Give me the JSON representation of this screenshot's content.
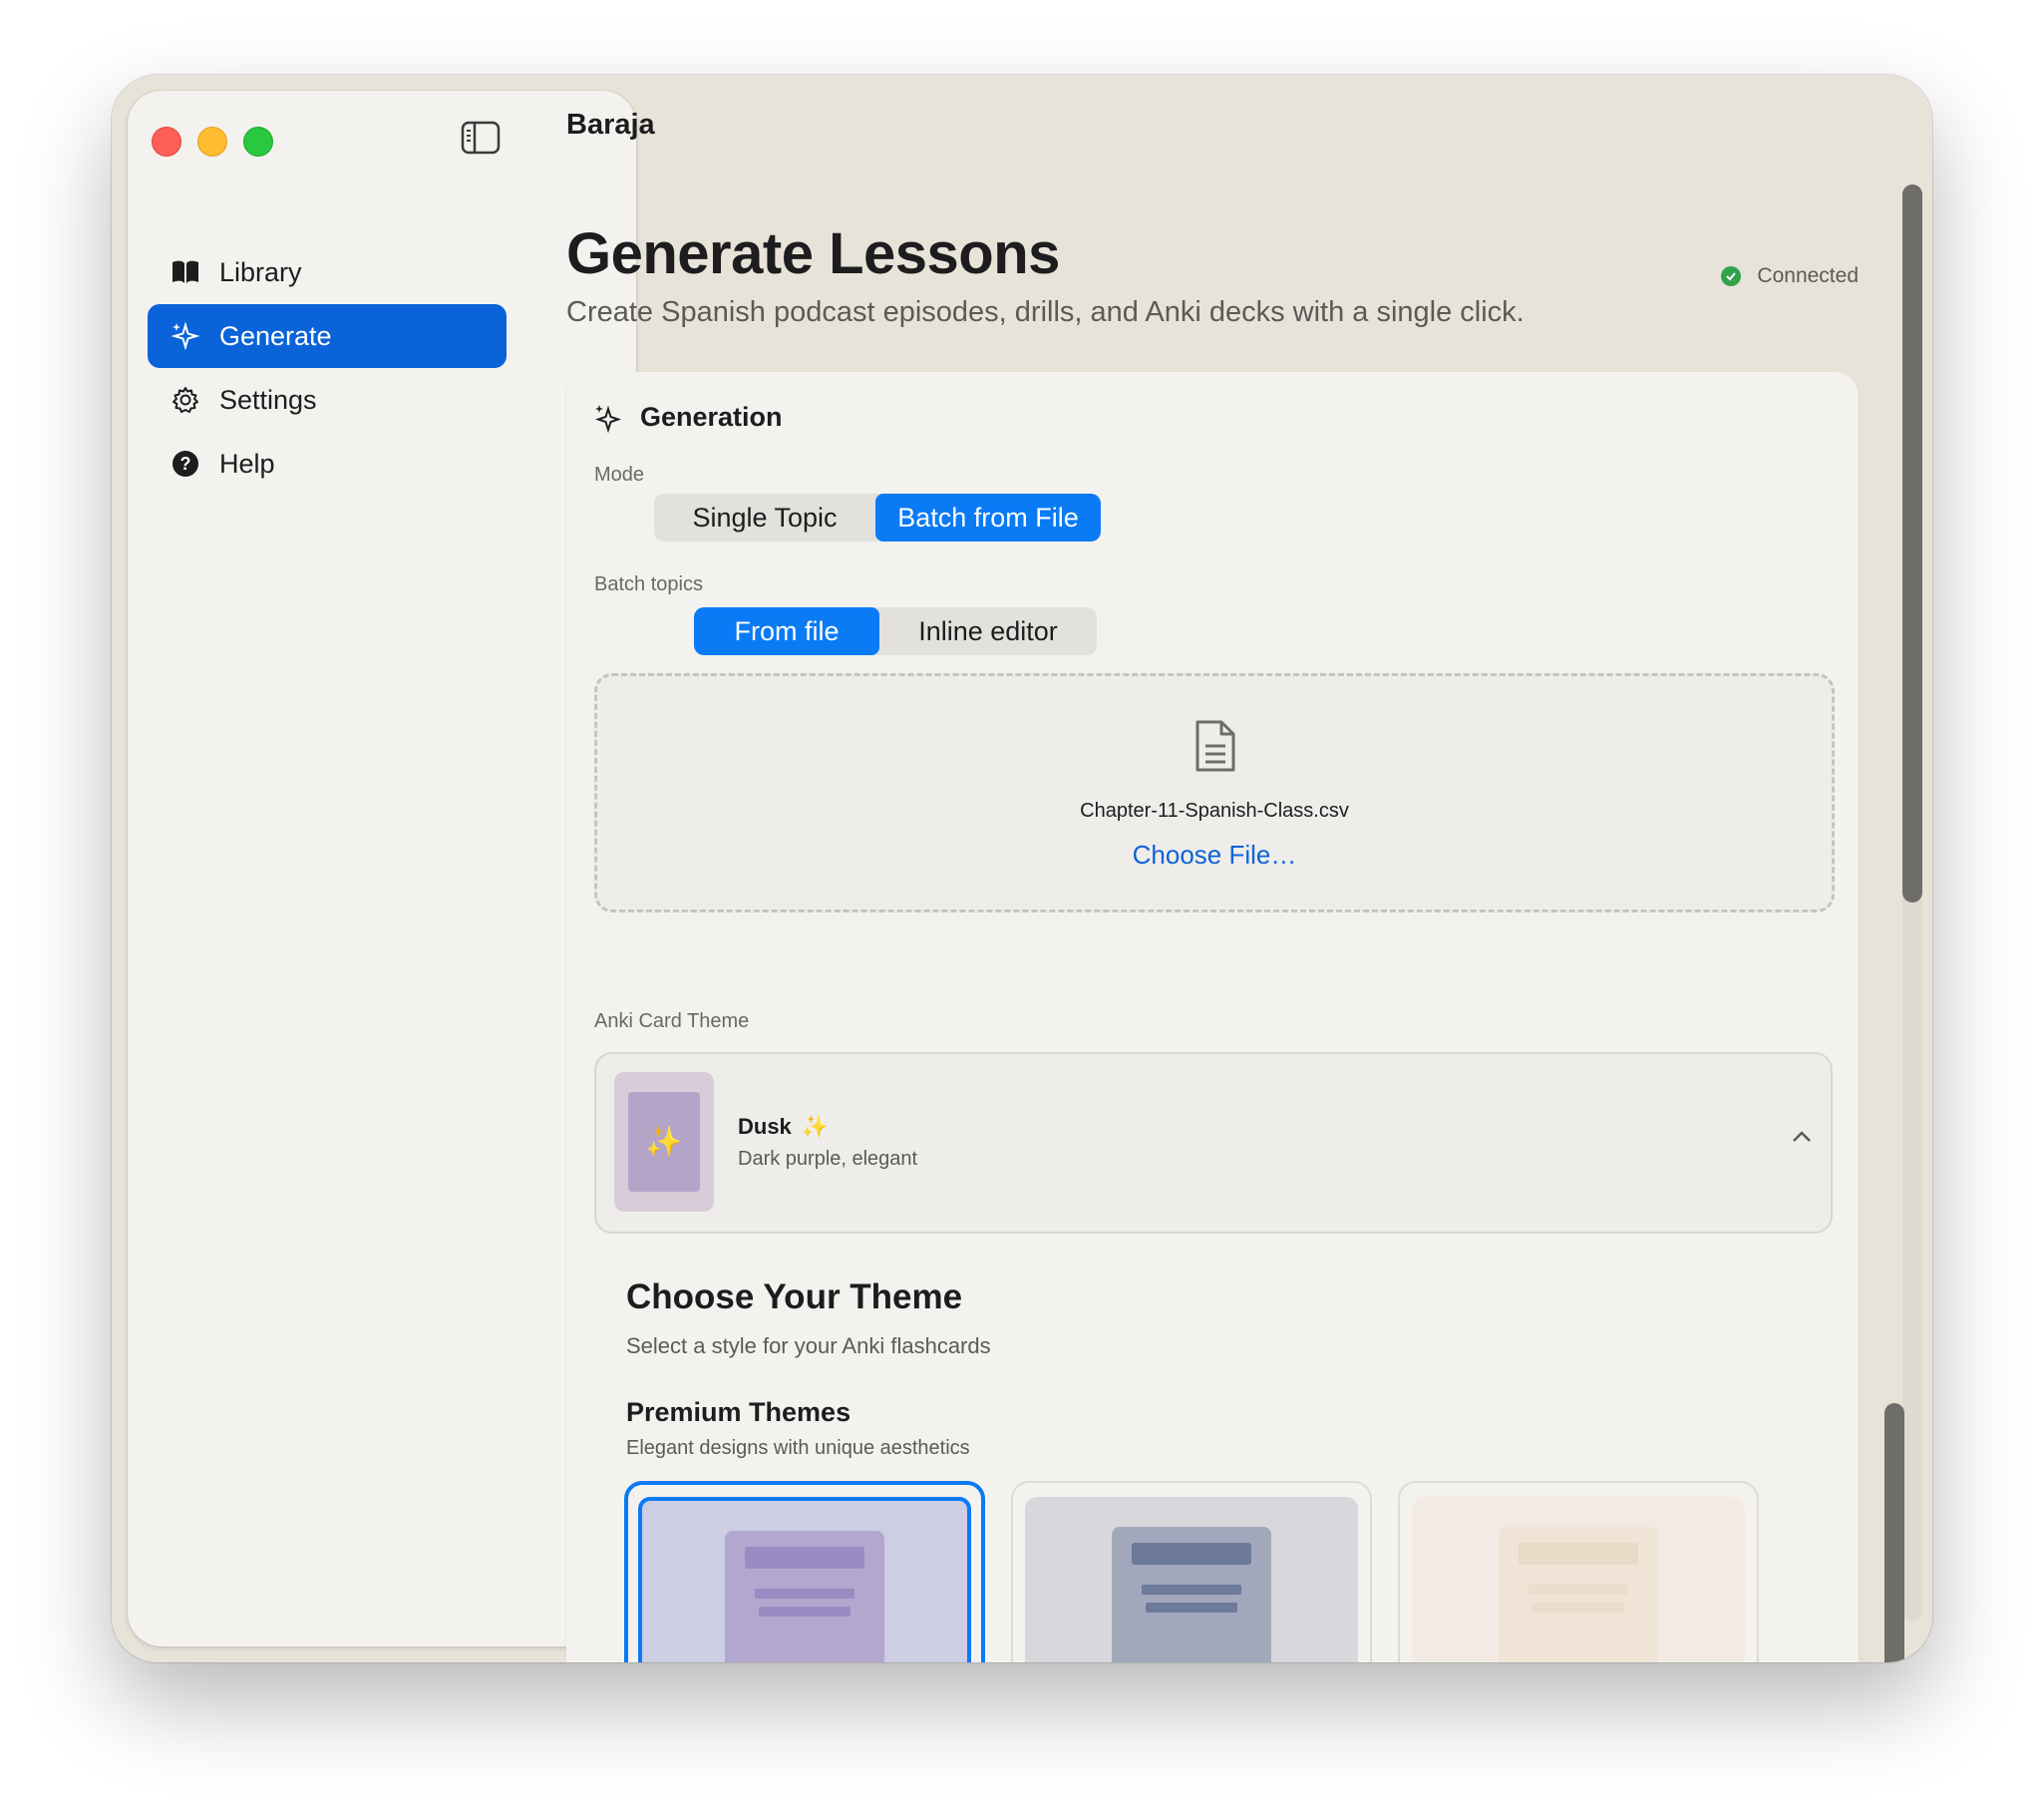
{
  "window": {
    "title": "Baraja"
  },
  "sidebar": {
    "items": [
      {
        "label": "Library",
        "icon": "book-icon",
        "active": false
      },
      {
        "label": "Generate",
        "icon": "sparkles-icon",
        "active": true
      },
      {
        "label": "Settings",
        "icon": "gear-icon",
        "active": false
      },
      {
        "label": "Help",
        "icon": "help-icon",
        "active": false
      }
    ]
  },
  "header": {
    "title": "Generate Lessons",
    "subtitle": "Create Spanish podcast episodes, drills, and Anki decks with a single click.",
    "status": "Connected"
  },
  "generation": {
    "title": "Generation",
    "mode_label": "Mode",
    "mode_options": [
      "Single Topic",
      "Batch from File"
    ],
    "mode_selected": "Batch from File",
    "batch_label": "Batch topics",
    "batch_options": [
      "From file",
      "Inline editor"
    ],
    "batch_selected": "From file",
    "file_name": "Chapter-11-Spanish-Class.csv",
    "choose_file": "Choose File…",
    "theme_label": "Anki Card Theme",
    "theme": {
      "name": "Dusk",
      "description": "Dark purple, elegant"
    }
  },
  "theme_picker": {
    "title": "Choose Your Theme",
    "subtitle": "Select a style for your Anki flashcards",
    "section_title": "Premium Themes",
    "section_subtitle": "Elegant designs with unique aesthetics"
  },
  "colors": {
    "accent": "#0a7af5",
    "sidebar_active": "#0a63d8",
    "connected": "#31a24c",
    "sparkle": "#f2d36b"
  }
}
